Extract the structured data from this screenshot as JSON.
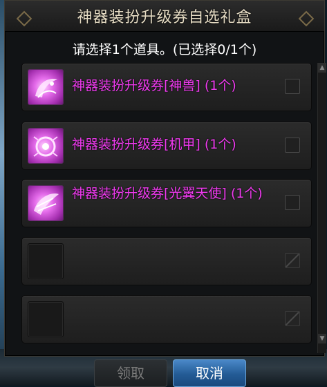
{
  "dialog": {
    "title": "神器装扮升级券自选礼盒",
    "subtitle": "请选择1个道具。(已选择0/1个)"
  },
  "items": [
    {
      "label": "神器装扮升级券[神兽] (1个)",
      "icon": "magic-swirl-icon",
      "checked": false
    },
    {
      "label": "神器装扮升级券[机甲] (1个)",
      "icon": "magic-swirl-icon",
      "checked": false
    },
    {
      "label": "神器装扮升级券[光翼天使] (1个)",
      "icon": "magic-swirl-icon",
      "checked": false
    },
    {
      "label": "",
      "icon": "empty-slot",
      "checked": false
    },
    {
      "label": "",
      "icon": "empty-slot",
      "checked": false
    }
  ],
  "buttons": {
    "claim_label": "领取",
    "cancel_label": "取消"
  },
  "colors": {
    "item_text": "#ee3aee",
    "cancel_button": "#235b95",
    "title_text": "#e6dcc4"
  }
}
